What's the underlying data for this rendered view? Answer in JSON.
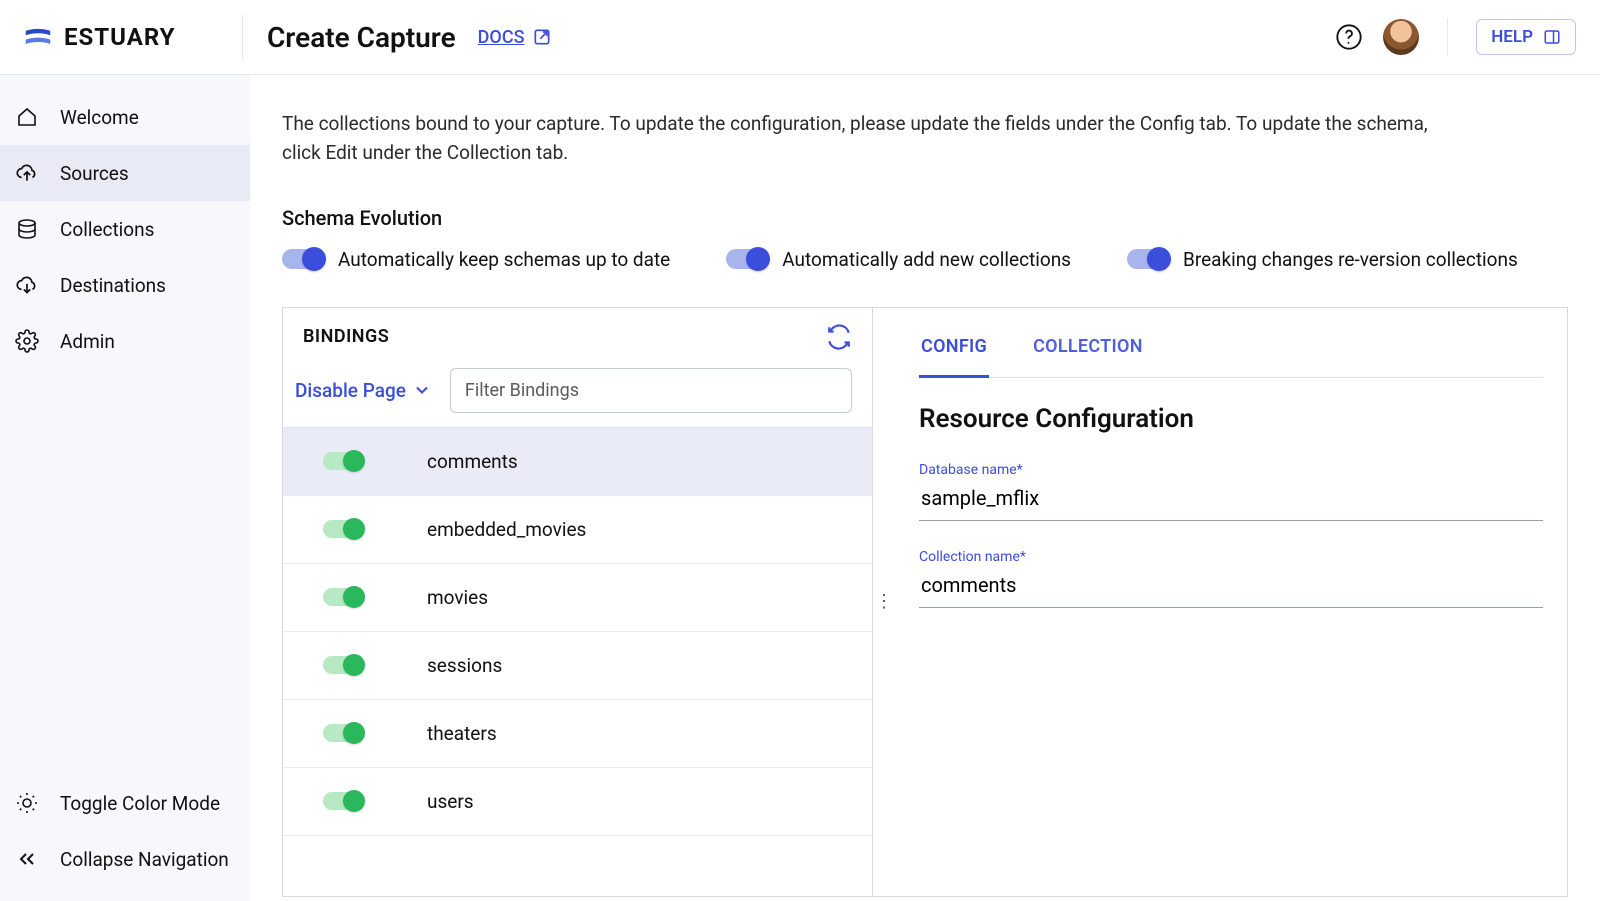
{
  "brand": {
    "name": "ESTUARY"
  },
  "header": {
    "title": "Create Capture",
    "docs_label": "DOCS",
    "help_label": "HELP"
  },
  "sidebar": {
    "items": [
      {
        "label": "Welcome"
      },
      {
        "label": "Sources"
      },
      {
        "label": "Collections"
      },
      {
        "label": "Destinations"
      },
      {
        "label": "Admin"
      }
    ],
    "bottom": [
      {
        "label": "Toggle Color Mode"
      },
      {
        "label": "Collapse Navigation"
      }
    ]
  },
  "main": {
    "intro": "The collections bound to your capture. To update the configuration, please update the fields under the Config tab. To update the schema, click Edit under the Collection tab.",
    "schema_evolution_title": "Schema Evolution",
    "toggles": [
      {
        "label": "Automatically keep schemas up to date"
      },
      {
        "label": "Automatically add new collections"
      },
      {
        "label": "Breaking changes re-version collections"
      }
    ]
  },
  "bindings": {
    "title": "BINDINGS",
    "disable_page_label": "Disable Page",
    "filter_placeholder": "Filter Bindings",
    "rows": [
      {
        "name": "comments"
      },
      {
        "name": "embedded_movies"
      },
      {
        "name": "movies"
      },
      {
        "name": "sessions"
      },
      {
        "name": "theaters"
      },
      {
        "name": "users"
      }
    ]
  },
  "config_panel": {
    "tabs": {
      "config": "CONFIG",
      "collection": "COLLECTION"
    },
    "title": "Resource Configuration",
    "fields": {
      "db_label": "Database name",
      "db_value": "sample_mflix",
      "coll_label": "Collection name",
      "coll_value": "comments",
      "required_marker": "*"
    }
  }
}
